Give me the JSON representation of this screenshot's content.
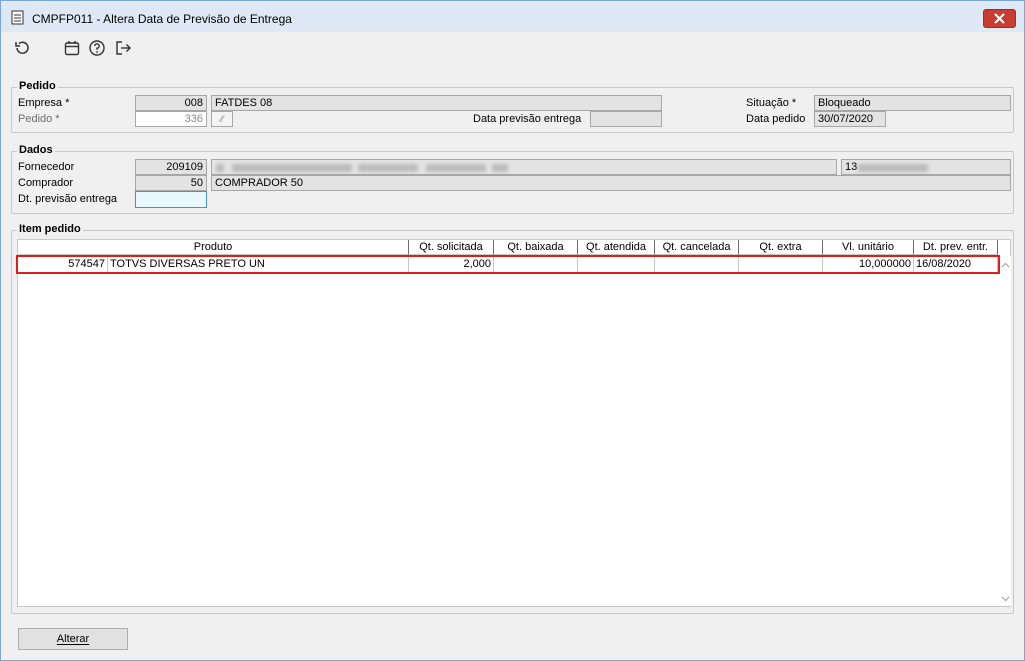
{
  "window": {
    "title": "CMPFP011 - Altera Data de Previsão de Entrega"
  },
  "toolbar": {
    "icons": [
      "refresh-icon",
      "calendar-icon",
      "help-icon",
      "exit-icon"
    ]
  },
  "pedido": {
    "title": "Pedido",
    "empresa_label": "Empresa *",
    "empresa_code": "008",
    "empresa_name": "FATDES 08",
    "pedido_label": "Pedido *",
    "pedido_value": "336",
    "data_previsao_label": "Data previsão entrega",
    "data_previsao_value": "",
    "situacao_label": "Situação *",
    "situacao_value": "Bloqueado",
    "data_pedido_label": "Data pedido",
    "data_pedido_value": "30/07/2020"
  },
  "dados": {
    "title": "Dados",
    "fornecedor_label": "Fornecedor",
    "fornecedor_code": "209109",
    "fornecedor_doc_prefix": "13",
    "comprador_label": "Comprador",
    "comprador_code": "50",
    "comprador_name": "COMPRADOR 50",
    "dt_previsao_label": "Dt. previsão entrega",
    "dt_previsao_value": ""
  },
  "itens": {
    "title": "Item pedido",
    "columns": [
      "Produto",
      "Qt. solicitada",
      "Qt. baixada",
      "Qt. atendida",
      "Qt. cancelada",
      "Qt. extra",
      "Vl. unitário",
      "Dt. prev. entr."
    ],
    "rows": [
      {
        "produto_code": "574547",
        "produto_desc": "TOTVS DIVERSAS PRETO UN",
        "qt_solicitada": "2,000",
        "qt_baixada": "",
        "qt_atendida": "",
        "qt_cancelada": "",
        "qt_extra": "",
        "vl_unitario": "10,000000",
        "dt_prev_entr": "16/08/2020"
      }
    ]
  },
  "footer": {
    "alterar_label": "Alterar"
  },
  "colors": {
    "highlight": "#e01c1c",
    "titlebar": "#dfe9f5",
    "close": "#c83c32"
  }
}
